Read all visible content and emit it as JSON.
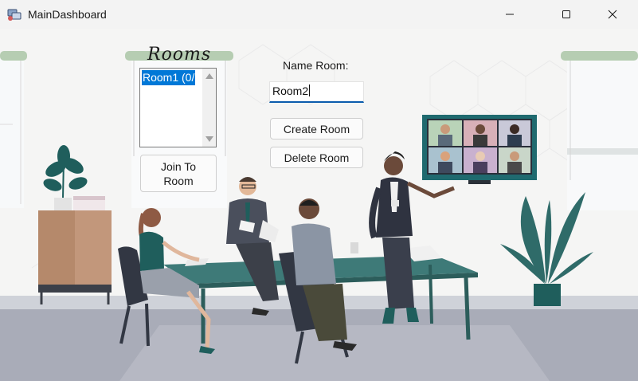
{
  "window": {
    "title": "MainDashboard"
  },
  "rooms": {
    "heading": "Rooms",
    "items": [
      "Room1 (0/"
    ]
  },
  "buttons": {
    "join": "Join To Room",
    "create": "Create Room",
    "delete": "Delete Room"
  },
  "name_room": {
    "label": "Name Room:",
    "value": "Room2"
  },
  "colors": {
    "selection": "#0078d7",
    "input_accent": "#0b5cad",
    "table": "#3e7a78"
  },
  "icons": [
    "app-icon",
    "minimize-icon",
    "maximize-icon",
    "close-icon"
  ]
}
